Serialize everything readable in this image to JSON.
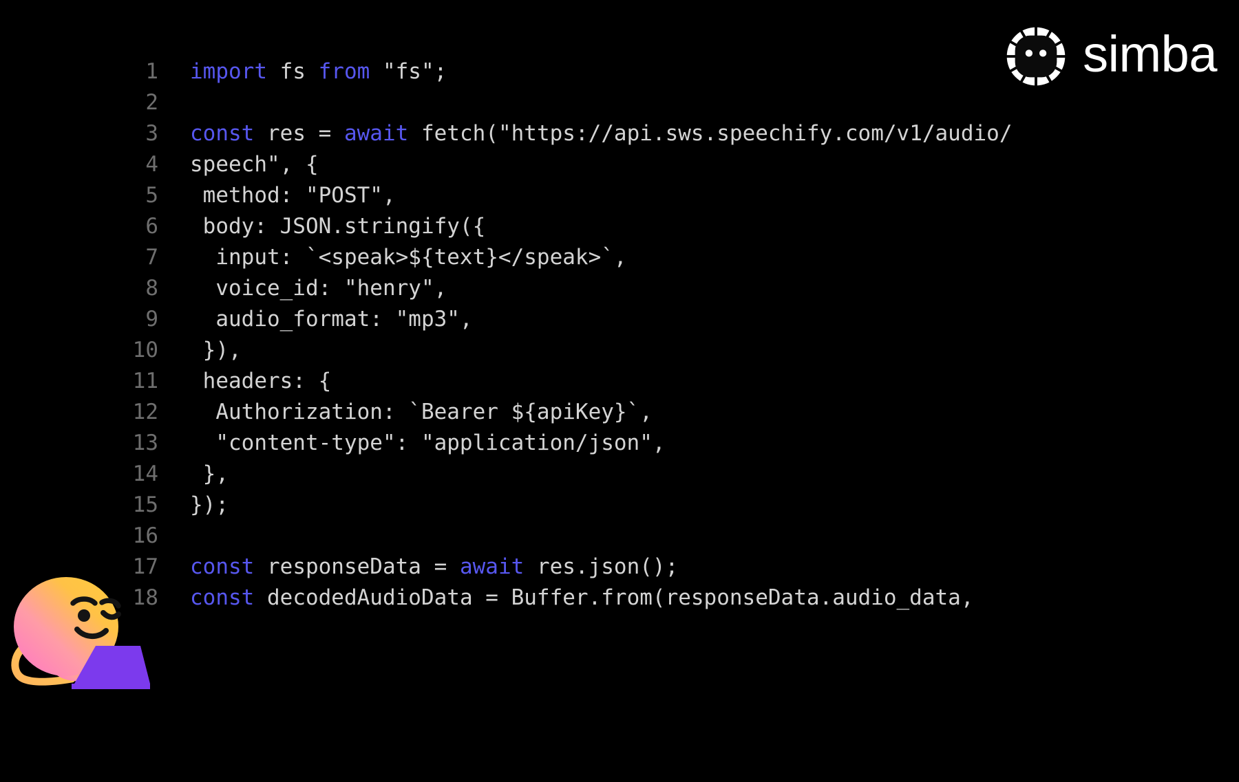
{
  "brand": {
    "logo_icon": "simba-sun-face-logo",
    "wordmark": "simba",
    "wordmark_color": "#ffffff",
    "logo_color": "#ffffff"
  },
  "editor": {
    "background_color": "#000000",
    "text_color": "#d4d4d4",
    "line_number_color": "#6e6e6e",
    "keyword_color": "#5757ef",
    "language": "javascript",
    "line_numbers": [
      "1",
      "2",
      "3",
      "4",
      "5",
      "6",
      "7",
      "8",
      "9",
      "10",
      "11",
      "12",
      "13",
      "14",
      "15",
      "16",
      "17",
      "18"
    ],
    "lines": [
      {
        "n": "1",
        "tokens": [
          {
            "t": "import",
            "c": "kw"
          },
          {
            "t": " fs ",
            "c": ""
          },
          {
            "t": "from",
            "c": "kw"
          },
          {
            "t": " \"fs\";",
            "c": ""
          }
        ]
      },
      {
        "n": "2",
        "tokens": []
      },
      {
        "n": "3",
        "tokens": [
          {
            "t": "const",
            "c": "kw"
          },
          {
            "t": " res = ",
            "c": ""
          },
          {
            "t": "await",
            "c": "kw"
          },
          {
            "t": " fetch(\"https://api.sws.speechify.com/v1/audio/",
            "c": ""
          }
        ]
      },
      {
        "n": "4",
        "tokens": [
          {
            "t": "speech\", {",
            "c": ""
          }
        ]
      },
      {
        "n": "5",
        "tokens": [
          {
            "t": " method: \"POST\",",
            "c": ""
          }
        ]
      },
      {
        "n": "6",
        "tokens": [
          {
            "t": " body: JSON.stringify({",
            "c": ""
          }
        ]
      },
      {
        "n": "7",
        "tokens": [
          {
            "t": "  input: `<speak>${text}</speak>`,",
            "c": ""
          }
        ]
      },
      {
        "n": "8",
        "tokens": [
          {
            "t": "  voice_id: \"henry\",",
            "c": ""
          }
        ]
      },
      {
        "n": "9",
        "tokens": [
          {
            "t": "  audio_format: \"mp3\",",
            "c": ""
          }
        ]
      },
      {
        "n": "10",
        "tokens": [
          {
            "t": " }),",
            "c": ""
          }
        ]
      },
      {
        "n": "11",
        "tokens": [
          {
            "t": " headers: {",
            "c": ""
          }
        ]
      },
      {
        "n": "12",
        "tokens": [
          {
            "t": "  Authorization: `Bearer ${apiKey}`,",
            "c": ""
          }
        ]
      },
      {
        "n": "13",
        "tokens": [
          {
            "t": "  \"content-type\": \"application/json\",",
            "c": ""
          }
        ]
      },
      {
        "n": "14",
        "tokens": [
          {
            "t": " },",
            "c": ""
          }
        ]
      },
      {
        "n": "15",
        "tokens": [
          {
            "t": "});",
            "c": ""
          }
        ]
      },
      {
        "n": "16",
        "tokens": []
      },
      {
        "n": "17",
        "tokens": [
          {
            "t": "const",
            "c": "kw"
          },
          {
            "t": " responseData = ",
            "c": ""
          },
          {
            "t": "await",
            "c": "kw"
          },
          {
            "t": " res.json();",
            "c": ""
          }
        ]
      },
      {
        "n": "18",
        "tokens": [
          {
            "t": "const",
            "c": "kw"
          },
          {
            "t": " decodedAudioData = Buffer.from(responseData.audio_data,",
            "c": ""
          }
        ]
      }
    ],
    "plain_text": "import fs from \"fs\";\n\nconst res = await fetch(\"https://api.sws.speechify.com/v1/audio/\nspeech\", {\n method: \"POST\",\n body: JSON.stringify({\n  input: `<speak>${text}</speak>`,\n  voice_id: \"henry\",\n  audio_format: \"mp3\",\n }),\n headers: {\n  Authorization: `Bearer ${apiKey}`,\n  \"content-type\": \"application/json\",\n },\n});\n\nconst responseData = await res.json();\nconst decodedAudioData = Buffer.from(responseData.audio_data,"
  },
  "mascot": {
    "icon": "smirking-face-with-laptop-mascot",
    "face_gradient_from": "#ffc845",
    "face_gradient_to": "#ff7fc0",
    "laptop_color": "#7c3aed",
    "feature_color": "#1a1a1a"
  }
}
